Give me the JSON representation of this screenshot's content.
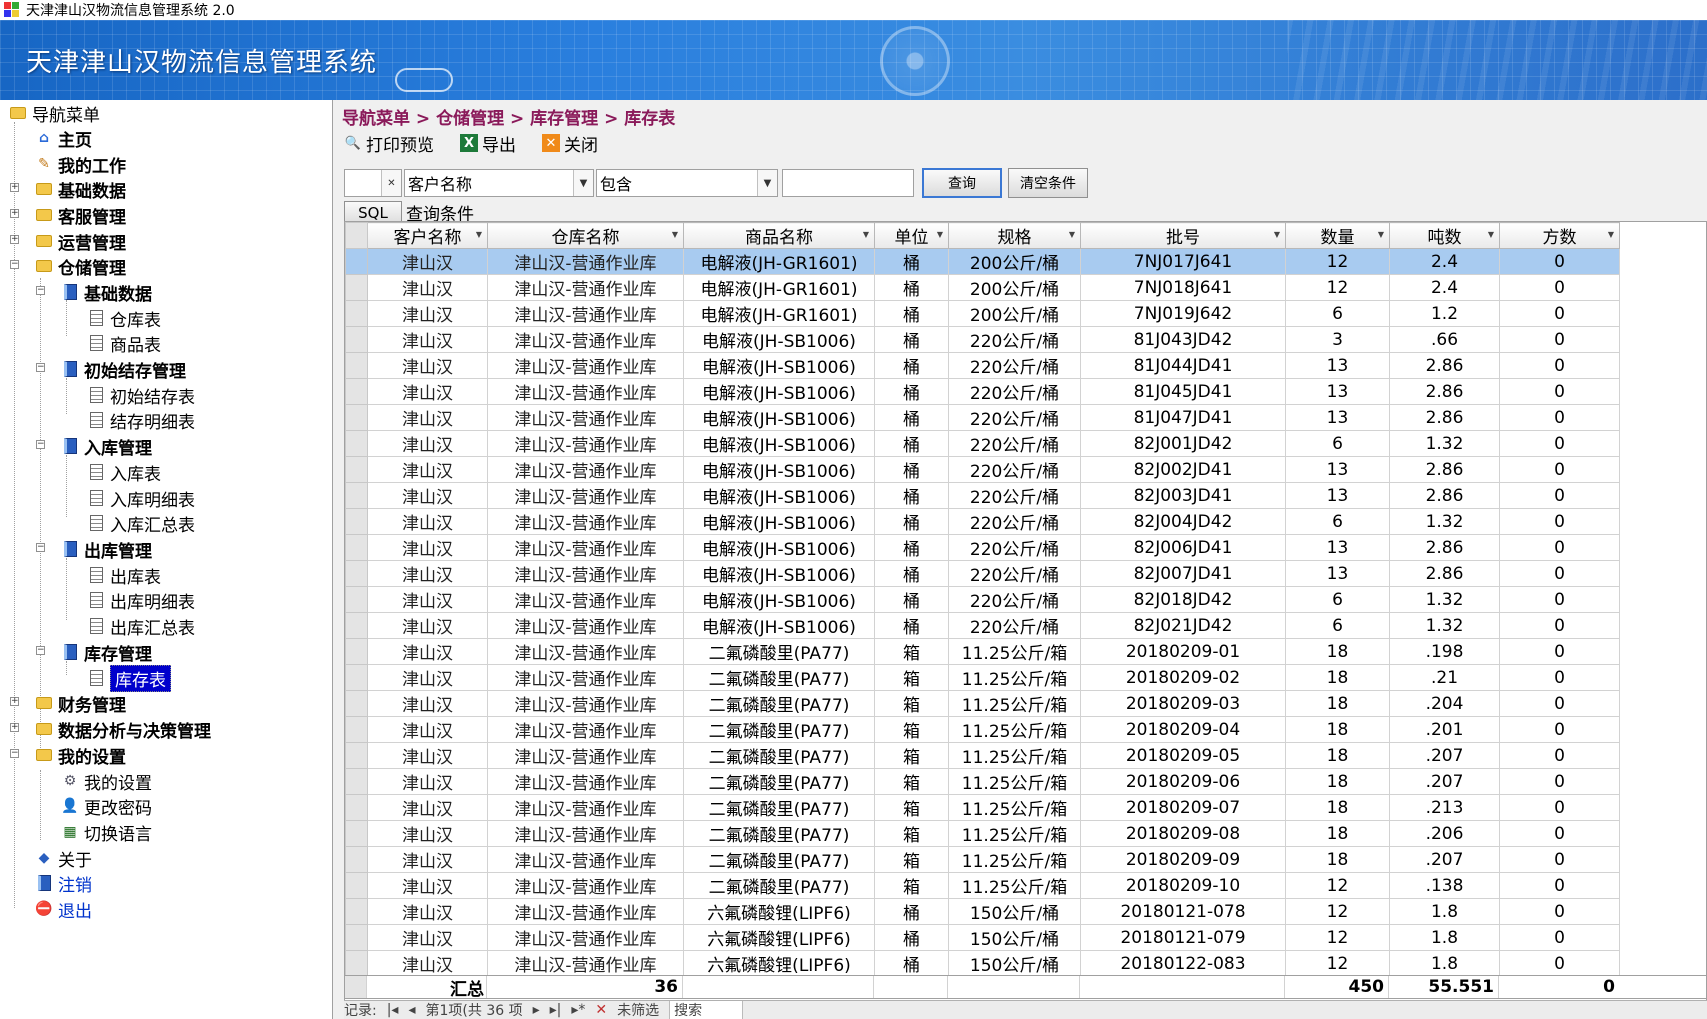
{
  "window": {
    "title": "天津津山汉物流信息管理系统 2.0"
  },
  "banner": {
    "title": "天津津山汉物流信息管理系统"
  },
  "sidebar": {
    "root": "导航菜单",
    "home": "主页",
    "my_work": "我的工作",
    "basic_data": "基础数据",
    "customer_service": "客服管理",
    "operations": "运营管理",
    "warehouse": "仓储管理",
    "wh_basic": "基础数据",
    "wh_table": "仓库表",
    "goods_table": "商品表",
    "init_mgmt": "初始结存管理",
    "init_table": "初始结存表",
    "init_detail": "结存明细表",
    "in_mgmt": "入库管理",
    "in_table": "入库表",
    "in_detail": "入库明细表",
    "in_summary": "入库汇总表",
    "out_mgmt": "出库管理",
    "out_table": "出库表",
    "out_detail": "出库明细表",
    "out_summary": "出库汇总表",
    "stock_mgmt": "库存管理",
    "stock_table": "库存表",
    "finance": "财务管理",
    "analysis": "数据分析与决策管理",
    "my_settings": "我的设置",
    "my_settings_item": "我的设置",
    "change_pwd": "更改密码",
    "switch_lang": "切换语言",
    "about": "关于",
    "logout": "注销",
    "exit": "退出"
  },
  "breadcrumb": "导航菜单 > 仓储管理 > 库存管理 > 库存表",
  "toolbar": {
    "print_preview": "打印预览",
    "export": "导出",
    "close": "关闭"
  },
  "filter": {
    "field": "客户名称",
    "operator": "包含",
    "value": "",
    "query_button": "查询",
    "clear_button": "清空条件",
    "sql_button": "SQL",
    "condition_label": "查询条件"
  },
  "table": {
    "columns": [
      "客户名称",
      "仓库名称",
      "商品名称",
      "单位",
      "规格",
      "批号",
      "数量",
      "吨数",
      "方数"
    ],
    "rows": [
      [
        "津山汉",
        "津山汉-营通作业库",
        "电解液(JH-GR1601)",
        "桶",
        "200公斤/桶",
        "7NJ017J641",
        "12",
        "2.4",
        "0"
      ],
      [
        "津山汉",
        "津山汉-营通作业库",
        "电解液(JH-GR1601)",
        "桶",
        "200公斤/桶",
        "7NJ018J641",
        "12",
        "2.4",
        "0"
      ],
      [
        "津山汉",
        "津山汉-营通作业库",
        "电解液(JH-GR1601)",
        "桶",
        "200公斤/桶",
        "7NJ019J642",
        "6",
        "1.2",
        "0"
      ],
      [
        "津山汉",
        "津山汉-营通作业库",
        "电解液(JH-SB1006)",
        "桶",
        "220公斤/桶",
        "81J043JD42",
        "3",
        ".66",
        "0"
      ],
      [
        "津山汉",
        "津山汉-营通作业库",
        "电解液(JH-SB1006)",
        "桶",
        "220公斤/桶",
        "81J044JD41",
        "13",
        "2.86",
        "0"
      ],
      [
        "津山汉",
        "津山汉-营通作业库",
        "电解液(JH-SB1006)",
        "桶",
        "220公斤/桶",
        "81J045JD41",
        "13",
        "2.86",
        "0"
      ],
      [
        "津山汉",
        "津山汉-营通作业库",
        "电解液(JH-SB1006)",
        "桶",
        "220公斤/桶",
        "81J047JD41",
        "13",
        "2.86",
        "0"
      ],
      [
        "津山汉",
        "津山汉-营通作业库",
        "电解液(JH-SB1006)",
        "桶",
        "220公斤/桶",
        "82J001JD42",
        "6",
        "1.32",
        "0"
      ],
      [
        "津山汉",
        "津山汉-营通作业库",
        "电解液(JH-SB1006)",
        "桶",
        "220公斤/桶",
        "82J002JD41",
        "13",
        "2.86",
        "0"
      ],
      [
        "津山汉",
        "津山汉-营通作业库",
        "电解液(JH-SB1006)",
        "桶",
        "220公斤/桶",
        "82J003JD41",
        "13",
        "2.86",
        "0"
      ],
      [
        "津山汉",
        "津山汉-营通作业库",
        "电解液(JH-SB1006)",
        "桶",
        "220公斤/桶",
        "82J004JD42",
        "6",
        "1.32",
        "0"
      ],
      [
        "津山汉",
        "津山汉-营通作业库",
        "电解液(JH-SB1006)",
        "桶",
        "220公斤/桶",
        "82J006JD41",
        "13",
        "2.86",
        "0"
      ],
      [
        "津山汉",
        "津山汉-营通作业库",
        "电解液(JH-SB1006)",
        "桶",
        "220公斤/桶",
        "82J007JD41",
        "13",
        "2.86",
        "0"
      ],
      [
        "津山汉",
        "津山汉-营通作业库",
        "电解液(JH-SB1006)",
        "桶",
        "220公斤/桶",
        "82J018JD42",
        "6",
        "1.32",
        "0"
      ],
      [
        "津山汉",
        "津山汉-营通作业库",
        "电解液(JH-SB1006)",
        "桶",
        "220公斤/桶",
        "82J021JD42",
        "6",
        "1.32",
        "0"
      ],
      [
        "津山汉",
        "津山汉-营通作业库",
        "二氟磷酸里(PA77)",
        "箱",
        "11.25公斤/箱",
        "20180209-01",
        "18",
        ".198",
        "0"
      ],
      [
        "津山汉",
        "津山汉-营通作业库",
        "二氟磷酸里(PA77)",
        "箱",
        "11.25公斤/箱",
        "20180209-02",
        "18",
        ".21",
        "0"
      ],
      [
        "津山汉",
        "津山汉-营通作业库",
        "二氟磷酸里(PA77)",
        "箱",
        "11.25公斤/箱",
        "20180209-03",
        "18",
        ".204",
        "0"
      ],
      [
        "津山汉",
        "津山汉-营通作业库",
        "二氟磷酸里(PA77)",
        "箱",
        "11.25公斤/箱",
        "20180209-04",
        "18",
        ".201",
        "0"
      ],
      [
        "津山汉",
        "津山汉-营通作业库",
        "二氟磷酸里(PA77)",
        "箱",
        "11.25公斤/箱",
        "20180209-05",
        "18",
        ".207",
        "0"
      ],
      [
        "津山汉",
        "津山汉-营通作业库",
        "二氟磷酸里(PA77)",
        "箱",
        "11.25公斤/箱",
        "20180209-06",
        "18",
        ".207",
        "0"
      ],
      [
        "津山汉",
        "津山汉-营通作业库",
        "二氟磷酸里(PA77)",
        "箱",
        "11.25公斤/箱",
        "20180209-07",
        "18",
        ".213",
        "0"
      ],
      [
        "津山汉",
        "津山汉-营通作业库",
        "二氟磷酸里(PA77)",
        "箱",
        "11.25公斤/箱",
        "20180209-08",
        "18",
        ".206",
        "0"
      ],
      [
        "津山汉",
        "津山汉-营通作业库",
        "二氟磷酸里(PA77)",
        "箱",
        "11.25公斤/箱",
        "20180209-09",
        "18",
        ".207",
        "0"
      ],
      [
        "津山汉",
        "津山汉-营通作业库",
        "二氟磷酸里(PA77)",
        "箱",
        "11.25公斤/箱",
        "20180209-10",
        "12",
        ".138",
        "0"
      ],
      [
        "津山汉",
        "津山汉-营通作业库",
        "六氟磷酸锂(LIPF6)",
        "桶",
        "150公斤/桶",
        "20180121-078",
        "12",
        "1.8",
        "0"
      ],
      [
        "津山汉",
        "津山汉-营通作业库",
        "六氟磷酸锂(LIPF6)",
        "桶",
        "150公斤/桶",
        "20180121-079",
        "12",
        "1.8",
        "0"
      ],
      [
        "津山汉",
        "津山汉-营通作业库",
        "六氟磷酸锂(LIPF6)",
        "桶",
        "150公斤/桶",
        "20180122-083",
        "12",
        "1.8",
        "0"
      ]
    ],
    "summary": {
      "label": "汇总",
      "count": "36",
      "quantity": "450",
      "tons": "55.551",
      "volume": "0"
    }
  },
  "statusbar": {
    "records_label": "记录:",
    "position": "第1项(共 36 项",
    "filter": "未筛选",
    "search": "搜索"
  },
  "colors": {
    "banner": "#2a7fde",
    "selected_row": "#a8cbf0",
    "breadcrumb": "#8a1a5a",
    "tree_selected": "#0000cc"
  }
}
